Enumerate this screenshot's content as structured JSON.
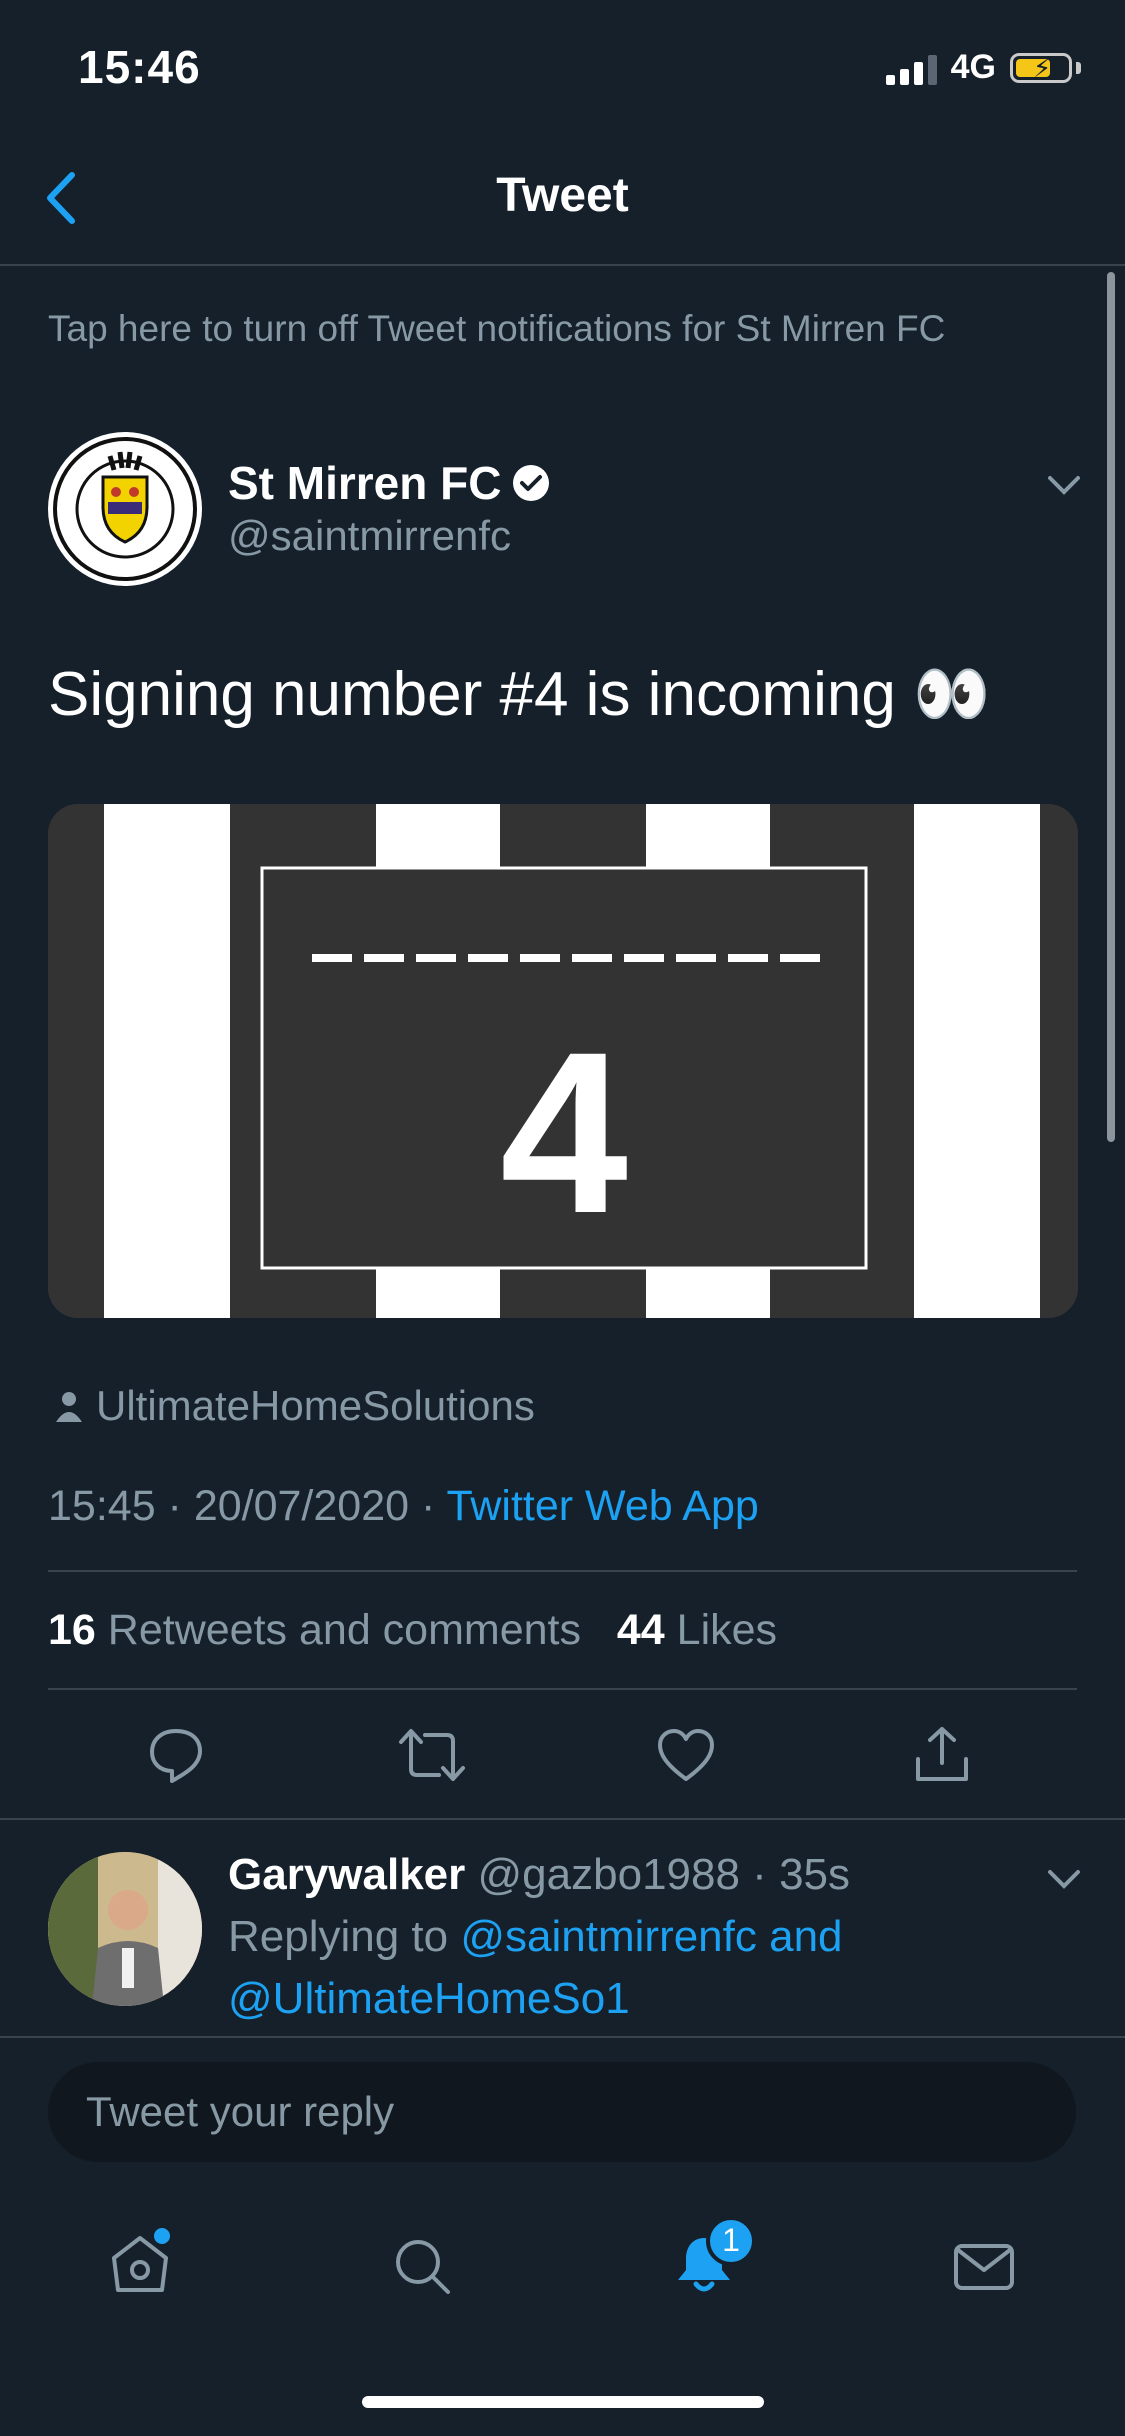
{
  "status_bar": {
    "time": "15:46",
    "network": "4G"
  },
  "header": {
    "title": "Tweet"
  },
  "notification_bar": {
    "text": "Tap here to turn off Tweet notifications for St Mirren FC"
  },
  "tweet": {
    "author_name": "St Mirren FC",
    "author_handle": "@saintmirrenfc",
    "text": "Signing number #4 is incoming 👀",
    "media_number": "4",
    "attribution": "UltimateHomeSolutions",
    "time": "15:45",
    "date": "20/07/2020",
    "source": "Twitter Web App",
    "retweets_count": "16",
    "retweets_label": "Retweets and comments",
    "likes_count": "44",
    "likes_label": "Likes"
  },
  "reply": {
    "name": "Garywalker",
    "handle": "@gazbo1988",
    "age": "35s",
    "replying_prefix": "Replying to",
    "replying_to_1": "@saintmirrenfc and",
    "replying_to_2": "@UltimateHomeSo1"
  },
  "compose": {
    "placeholder": "Tweet your reply"
  },
  "tab_bar": {
    "notifications_badge": "1"
  },
  "colors": {
    "background": "#15202b",
    "accent": "#1da1f2",
    "muted": "#8899a6",
    "battery": "#f5c518"
  }
}
